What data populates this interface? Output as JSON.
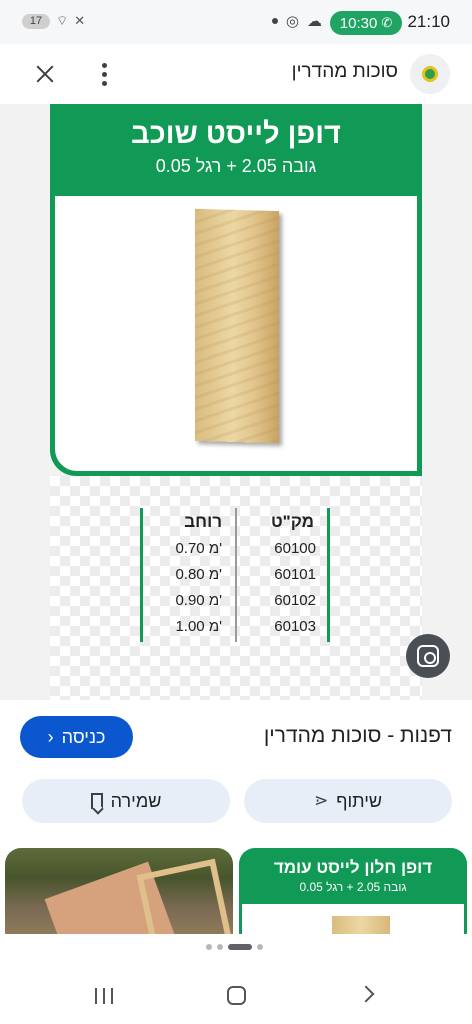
{
  "status_bar": {
    "time": "21:10",
    "call_time": "10:30",
    "battery": "17"
  },
  "top_bar": {
    "site_name": "סוכות מהדרין"
  },
  "product_image": {
    "title": "דופן לייסט שוכב",
    "subtitle": "גובה 2.05 + רגל 0.05",
    "table": {
      "headers": [
        "מק\"ט",
        "רוחב"
      ],
      "rows": [
        [
          "60100",
          "0.70 מ'"
        ],
        [
          "60101",
          "0.80 מ'"
        ],
        [
          "60102",
          "0.90 מ'"
        ],
        [
          "60103",
          "1.00 מ'"
        ]
      ]
    }
  },
  "info": {
    "title": "דפנות - סוכות מהדרין",
    "visit_label": "כניסה",
    "share_label": "שיתוף",
    "save_label": "שמירה"
  },
  "related": {
    "card_title": "דופן חלון לייסט עומד",
    "card_subtitle": "גובה 2.05 + רגל 0.05"
  },
  "colors": {
    "brand_green": "#109a55",
    "primary_blue": "#0b57d0",
    "call_green": "#1fa463"
  }
}
